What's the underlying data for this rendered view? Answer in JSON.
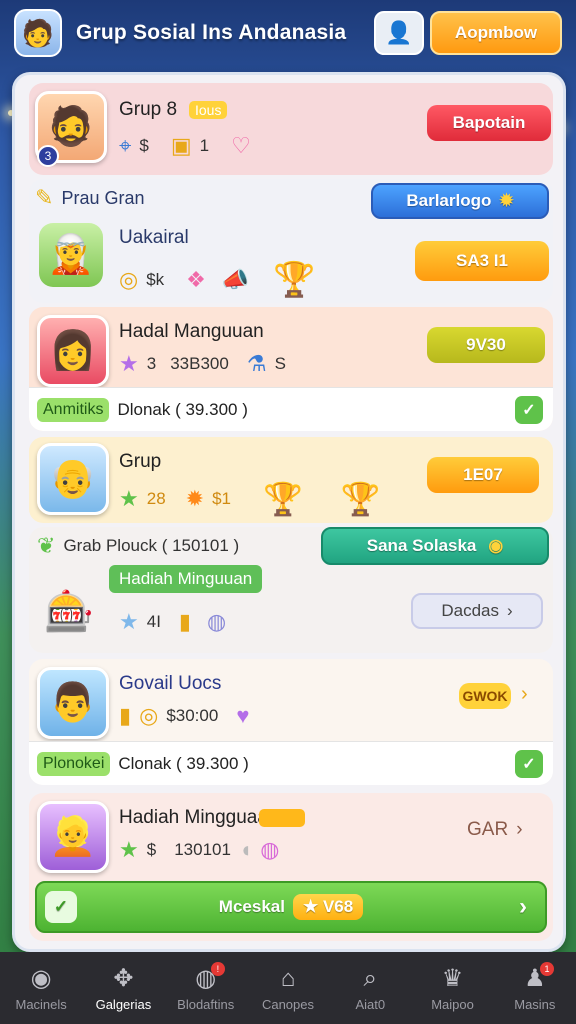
{
  "header": {
    "title": "Grup Sosial Ins Andanasia",
    "cta_label": "Aopmbow"
  },
  "cards": [
    {
      "name": "Grup 8",
      "tag": "Ious",
      "stat_a": "$",
      "stat_b": "1",
      "button": "Bapotain"
    },
    {
      "section_label": "Prau Gran",
      "name": "Uakairal",
      "stat_a": "$k",
      "button_top": "Barlarlogo",
      "button": "SA3 I1"
    },
    {
      "name": "Hadal Manguuan",
      "stat_a": "3",
      "stat_b": "33B300",
      "stat_c": "S",
      "button": "9V30",
      "tag": "Anmitiks",
      "detail": "Dlonak ( 39.300 )"
    },
    {
      "name": "Grup",
      "stat_a": "28",
      "stat_b": "$1",
      "button": "1E07"
    },
    {
      "name": "Grab Plouck ( 150101 )",
      "button": "Sana Solaska",
      "label_tag": "Hadiah Minguuan",
      "stat_a": "4I",
      "pill": "Dacdas"
    },
    {
      "name": "Govail Uocs",
      "stat_a": "$30:00",
      "button": "GWOK",
      "tag": "Plonokei",
      "detail": "Clonak ( 39.300 )"
    },
    {
      "name": "Hadiah Mingguaa",
      "stat_a": "$",
      "stat_b": "130101",
      "value": "GAR",
      "action_label": "Mceskal",
      "action_badge": "V68"
    }
  ],
  "nav": {
    "items": [
      {
        "label": "Macinels",
        "icon": "player-icon",
        "active": false
      },
      {
        "label": "Galgerias",
        "icon": "gamepad-icon",
        "active": true
      },
      {
        "label": "Blodaftins",
        "icon": "chat-icon",
        "active": false
      },
      {
        "label": "Canopes",
        "icon": "home-icon",
        "active": false
      },
      {
        "label": "Aiat0",
        "icon": "search-icon",
        "active": false
      },
      {
        "label": "Maipoo",
        "icon": "trophy-icon",
        "active": false
      },
      {
        "label": "Masins",
        "icon": "profile-icon",
        "active": false
      }
    ]
  },
  "colors": {
    "accent_orange": "#ff9b0e",
    "accent_red": "#e02b3a",
    "accent_blue": "#2d6fd8",
    "accent_green": "#4db332",
    "nav_bg": "#2b2b30"
  }
}
